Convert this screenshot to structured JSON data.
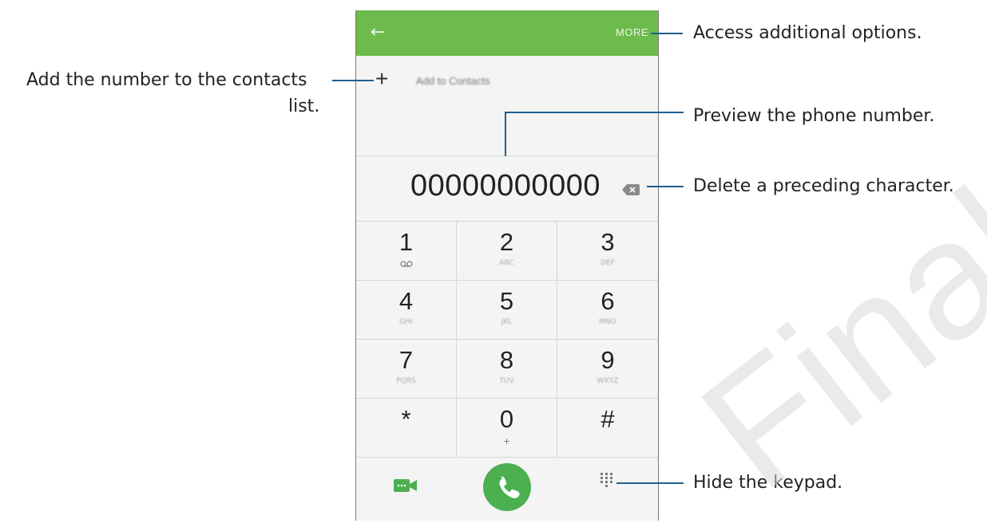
{
  "app": {
    "header": {
      "more_label": "MORE",
      "bar_color": "#6dbb4c"
    },
    "add_contacts_label": "Add to Contacts",
    "phone_number": "00000000000",
    "keys": [
      {
        "digit": "1",
        "sub": ""
      },
      {
        "digit": "2",
        "sub": "ABC"
      },
      {
        "digit": "3",
        "sub": "DEF"
      },
      {
        "digit": "4",
        "sub": "GHI"
      },
      {
        "digit": "5",
        "sub": "JKL"
      },
      {
        "digit": "6",
        "sub": "MNO"
      },
      {
        "digit": "7",
        "sub": "PQRS"
      },
      {
        "digit": "8",
        "sub": "TUV"
      },
      {
        "digit": "9",
        "sub": "WXYZ"
      },
      {
        "digit": "*",
        "sub": ""
      },
      {
        "digit": "0",
        "sub": "+"
      },
      {
        "digit": "#",
        "sub": ""
      }
    ],
    "hide_keypad_label": "HIDE",
    "accent": "#4caf50"
  },
  "callouts": {
    "more": "Access additional options.",
    "add_contacts_line1": "Add the number to the contacts",
    "add_contacts_line2": "list.",
    "preview": "Preview the phone number.",
    "delete": "Delete a preceding character.",
    "hide": "Hide the keypad."
  },
  "watermark": "Final"
}
